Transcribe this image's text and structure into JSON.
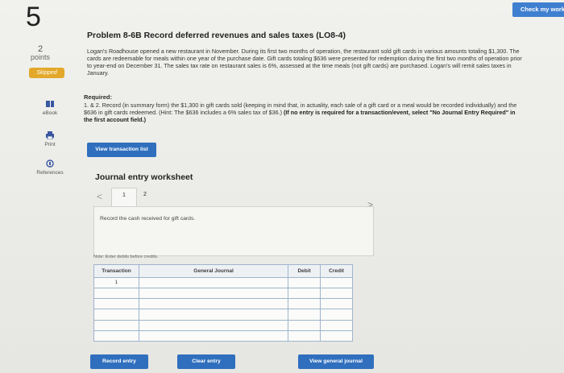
{
  "question": {
    "number": "5",
    "points_value": "2",
    "points_label": "points",
    "status_badge": "Skipped"
  },
  "rail": {
    "ebook": "eBook",
    "print": "Print",
    "references": "References"
  },
  "header": {
    "check_button": "Check my work"
  },
  "problem": {
    "title": "Problem 8-6B Record deferred revenues and sales taxes (LO8-4)",
    "intro": "Logan's Roadhouse opened a new restaurant in November. During its first two months of operation, the restaurant sold gift cards in various amounts totaling $1,300. The cards are redeemable for meals within one year of the purchase date. Gift cards totaling $636 were presented for redemption during the first two months of operation prior to year-end on December 31. The sales tax rate on restaurant sales is 6%, assessed at the time meals (not gift cards) are purchased. Logan's will remit sales taxes in January.",
    "required_heading": "Required:",
    "required_text": "1. & 2. Record (in summary form) the $1,300 in gift cards sold (keeping in mind that, in actuality, each sale of a gift card or a meal would be recorded individually) and the $636 in gift cards redeemed. (Hint: The $636 includes a 6% sales tax of $36.)",
    "required_bold": "(If no entry is required for a transaction/event, select \"No Journal Entry Required\" in the first account field.)"
  },
  "buttons": {
    "view_transaction_list": "View transaction list",
    "record_entry": "Record entry",
    "clear_entry": "Clear entry",
    "view_general_journal": "View general journal"
  },
  "worksheet": {
    "title": "Journal entry worksheet",
    "tab_prev": "<",
    "tab_1": "1",
    "tab_2": "2",
    "tab_next": ">",
    "instruction": "Record the cash received for gift cards.",
    "note": "Note: Enter debits before credits.",
    "columns": [
      "Transaction",
      "General Journal",
      "Debit",
      "Credit"
    ],
    "rows": [
      {
        "transaction": "1"
      },
      {
        "transaction": ""
      },
      {
        "transaction": ""
      },
      {
        "transaction": ""
      },
      {
        "transaction": ""
      },
      {
        "transaction": ""
      }
    ]
  }
}
